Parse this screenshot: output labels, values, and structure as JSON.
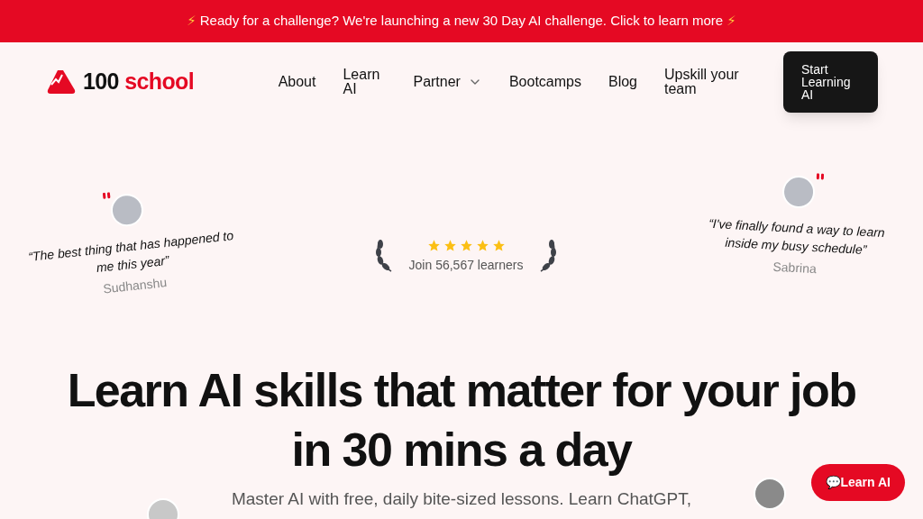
{
  "banner": {
    "bolt_left": "⚡",
    "text": "Ready for a challenge? We're launching a new 30 Day AI challenge. Click to learn more",
    "bolt_right": "⚡"
  },
  "logo": {
    "number": "100",
    "word": "school"
  },
  "nav": [
    {
      "label": "About",
      "dropdown": false
    },
    {
      "label": "Learn AI",
      "dropdown": false
    },
    {
      "label": "Partner",
      "dropdown": true
    },
    {
      "label": "Bootcamps",
      "dropdown": false
    },
    {
      "label": "Blog",
      "dropdown": false
    },
    {
      "label": "Upskill your team",
      "dropdown": false
    }
  ],
  "cta": "Start Learning AI",
  "testimonials": [
    {
      "quote": "“The best thing that has happened to me this year”",
      "name": "Sudhanshu"
    },
    {
      "quote": "“I've finally found a way to learn inside my busy schedule”",
      "name": "Sabrina"
    }
  ],
  "rating": {
    "stars": 5,
    "text": "Join 56,567 learners"
  },
  "headline": "Learn AI skills that matter for your job in 30 mins a day",
  "subtitle": "Master AI with free, daily bite-sized lessons. Learn ChatGPT,",
  "chat_button": {
    "icon": "💬",
    "label": "Learn AI"
  }
}
